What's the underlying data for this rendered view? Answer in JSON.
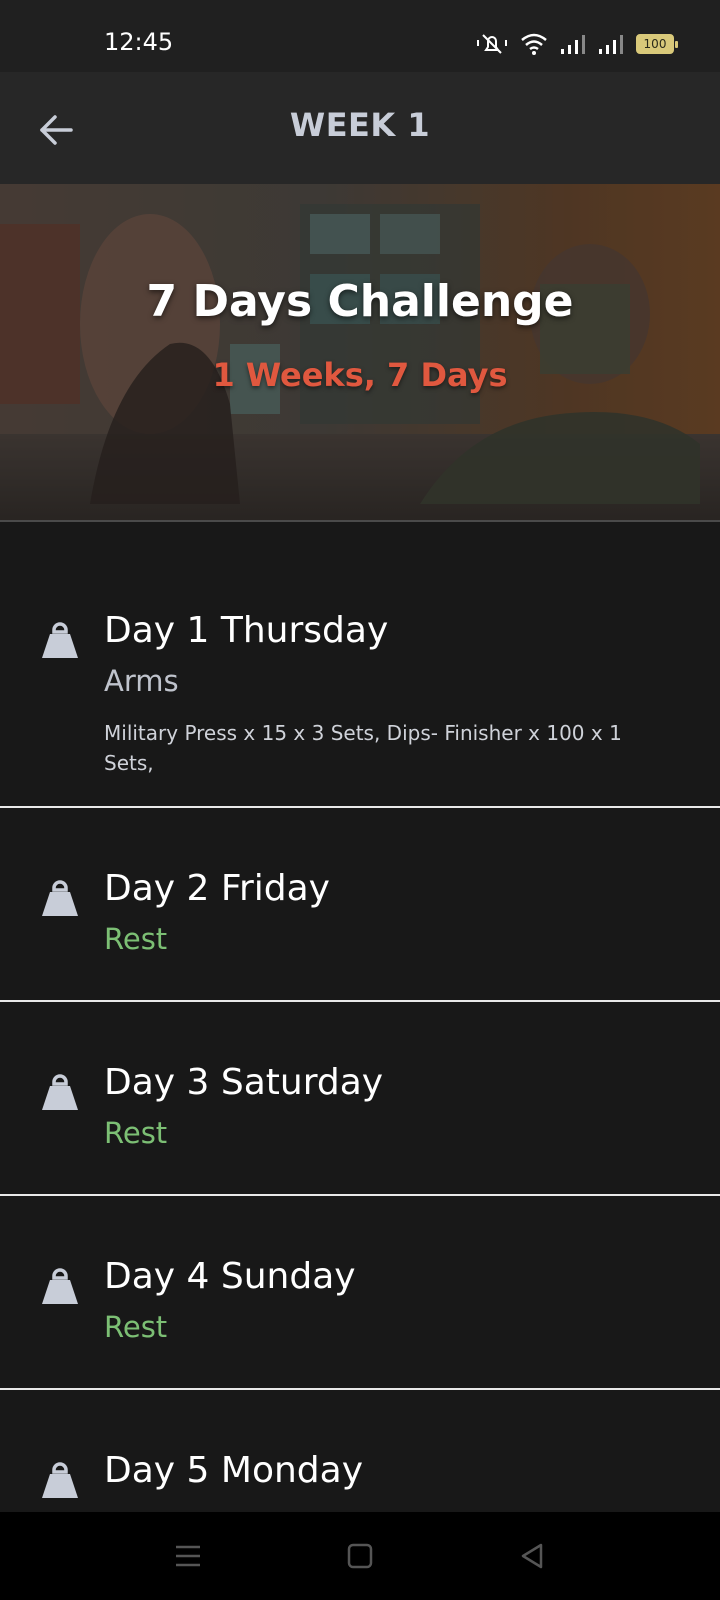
{
  "status_bar": {
    "time": "12:45",
    "battery": "100",
    "icons": [
      "mute-bell-icon",
      "wifi-icon",
      "signal-icon",
      "signal-icon",
      "battery-icon"
    ]
  },
  "app_bar": {
    "title": "WEEK 1",
    "back_icon": "arrow-left-icon"
  },
  "hero": {
    "title": "7 Days Challenge",
    "subtitle": "1 Weeks, 7 Days",
    "subtitle_color": "#e0583f"
  },
  "days": [
    {
      "title": "Day 1 Thursday",
      "focus": "Arms",
      "detail": "Military Press x 15 x 3 Sets, Dips- Finisher x 100 x 1 Sets,"
    },
    {
      "title": "Day 2 Friday",
      "status": "Rest"
    },
    {
      "title": "Day 3 Saturday",
      "status": "Rest"
    },
    {
      "title": "Day 4 Sunday",
      "status": "Rest"
    },
    {
      "title": "Day 5 Monday"
    }
  ],
  "colors": {
    "background": "#181818",
    "rest": "#7cbf74",
    "divider": "#e8e8e8"
  },
  "nav_bar": {
    "icons": [
      "menu-icon",
      "home-square-icon",
      "back-triangle-icon"
    ]
  }
}
